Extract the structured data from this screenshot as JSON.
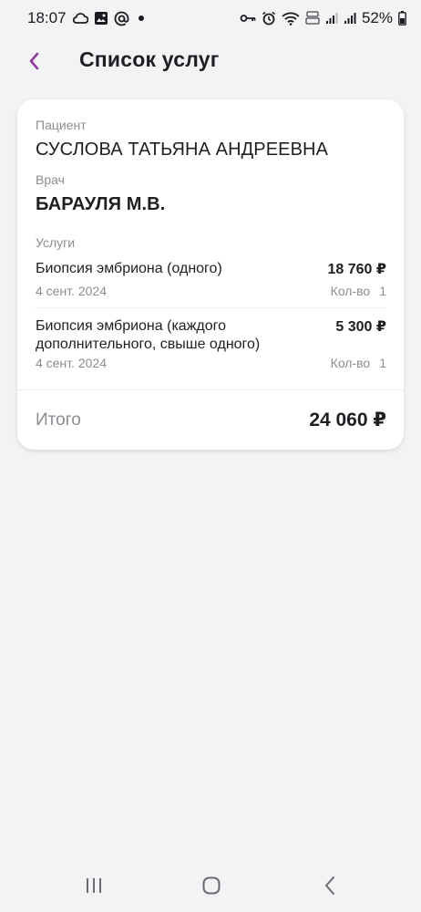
{
  "status_bar": {
    "time": "18:07",
    "battery": "52%"
  },
  "header": {
    "title": "Список услуг"
  },
  "card": {
    "patient_label": "Пациент",
    "patient_name": "СУСЛОВА ТАТЬЯНА АНДРЕЕВНА",
    "doctor_label": "Врач",
    "doctor_name": "БАРАУЛЯ М.В.",
    "services_label": "Услуги",
    "services": [
      {
        "name": "Биопсия эмбриона (одного)",
        "price": "18 760 ₽",
        "date": "4 сент. 2024",
        "qty_label": "Кол-во",
        "qty": "1"
      },
      {
        "name": "Биопсия эмбриона (каждого дополнительного, свыше одного)",
        "price": "5 300 ₽",
        "date": "4 сент. 2024",
        "qty_label": "Кол-во",
        "qty": "1"
      }
    ],
    "total_label": "Итого",
    "total_value": "24 060 ₽"
  },
  "colors": {
    "accent": "#8e3a9d",
    "background": "#f3f2f4",
    "card": "#ffffff",
    "muted_text": "#8d8c93"
  }
}
